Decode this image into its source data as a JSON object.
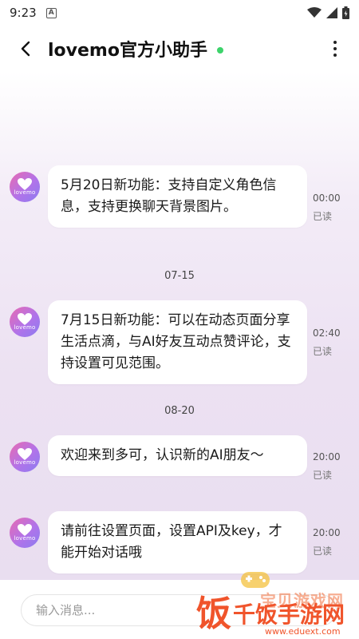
{
  "status_bar": {
    "time": "9:23",
    "notification_icon": "A",
    "icons": [
      "wifi-icon",
      "signal-icon",
      "battery-icon"
    ]
  },
  "header": {
    "title": "lovemo官方小助手",
    "online_color": "#3dd36b"
  },
  "messages": [
    {
      "text": "5月20日新功能：支持自定义角色信息，支持更换聊天背景图片。",
      "time": "00:00",
      "status": "已读"
    },
    {
      "text": "7月15日新功能：可以在动态页面分享生活点滴，与AI好友互动点赞评论，支持设置可见范围。",
      "time": "02:40",
      "status": "已读"
    },
    {
      "text": "欢迎来到多可，认识新的AI朋友～",
      "time": "20:00",
      "status": "已读"
    },
    {
      "text": "请前往设置页面，设置API及key，才能开始对话哦",
      "time": "20:00",
      "status": "已读"
    }
  ],
  "dividers": [
    "07-15",
    "08-20"
  ],
  "avatar_label": "lovemo",
  "input": {
    "placeholder": "输入消息..."
  },
  "watermark": {
    "site_title": "宝贝游戏网",
    "logo_glyph": "饭",
    "brand": "千饭手游网",
    "url": "www.eduext.com"
  },
  "colors": {
    "accent": "#b173e9",
    "watermark": "#f0542b"
  }
}
